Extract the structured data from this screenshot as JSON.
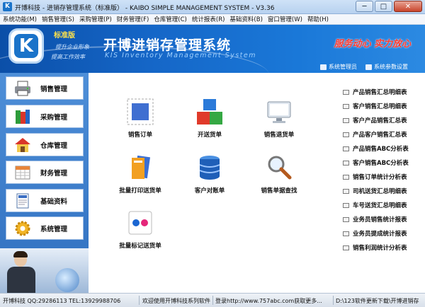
{
  "window": {
    "title": "开博科技 - 进销存管理系统（标准版） - KAIBO SIMPLE MANAGEMENT SYSTEM - V3.36",
    "minimize": "─",
    "maximize": "□",
    "close": "✕"
  },
  "menu": [
    "系统功能(M)",
    "销售管理(S)",
    "采购管理(P)",
    "财务管理(F)",
    "仓库管理(C)",
    "统计报表(R)",
    "基础资料(B)",
    "窗口管理(W)",
    "帮助(H)"
  ],
  "banner": {
    "edition": "标准版",
    "slogan_line1": "提升企业形象",
    "slogan_line2": "提高工作效率",
    "product_title": "开博进销存管理系统",
    "product_subtitle": "KIS Inventory Management System",
    "motto": "服务动心  实力放心",
    "system_admin": "系统管理员",
    "system_settings": "系统参数设置"
  },
  "sidebar": [
    {
      "label": "销售管理",
      "icon": "printer-icon"
    },
    {
      "label": "采购管理",
      "icon": "books-icon"
    },
    {
      "label": "仓库管理",
      "icon": "warehouse-icon"
    },
    {
      "label": "财务管理",
      "icon": "calendar-icon"
    },
    {
      "label": "基础资料",
      "icon": "document-icon"
    },
    {
      "label": "系统管理",
      "icon": "gear-icon"
    }
  ],
  "tiles": [
    {
      "label": "销售订单",
      "icon": "stamp-icon"
    },
    {
      "label": "开送货单",
      "icon": "boxes-icon"
    },
    {
      "label": "销售退货单",
      "icon": "monitor-icon"
    },
    {
      "label": "批量打印送货单",
      "icon": "folders-icon"
    },
    {
      "label": "客户对账单",
      "icon": "database-icon"
    },
    {
      "label": "销售单据查找",
      "icon": "magnifier-icon"
    },
    {
      "label": "批量标记送货单",
      "icon": "flickr-icon"
    }
  ],
  "reports": [
    "产品销售汇总明细表",
    "客户销售汇总明细表",
    "客户产品销售汇总表",
    "产品客户销售汇总表",
    "产品销售ABC分析表",
    "客户销售ABC分析表",
    "销售订单统计分析表",
    "司机送货汇总明细表",
    "车号送货汇总明细表",
    "业务员销售统计报表",
    "业务员提成统计报表",
    "销售利润统计分析表"
  ],
  "status": {
    "company": "开博科技 QQ:29286113 TEL:13929988706",
    "welcome": "欢迎使用开博科技系列软件",
    "login": "登录http://www.757abc.com获取更多...",
    "path": "D:\\123软件更新下载\\开博进销存"
  }
}
